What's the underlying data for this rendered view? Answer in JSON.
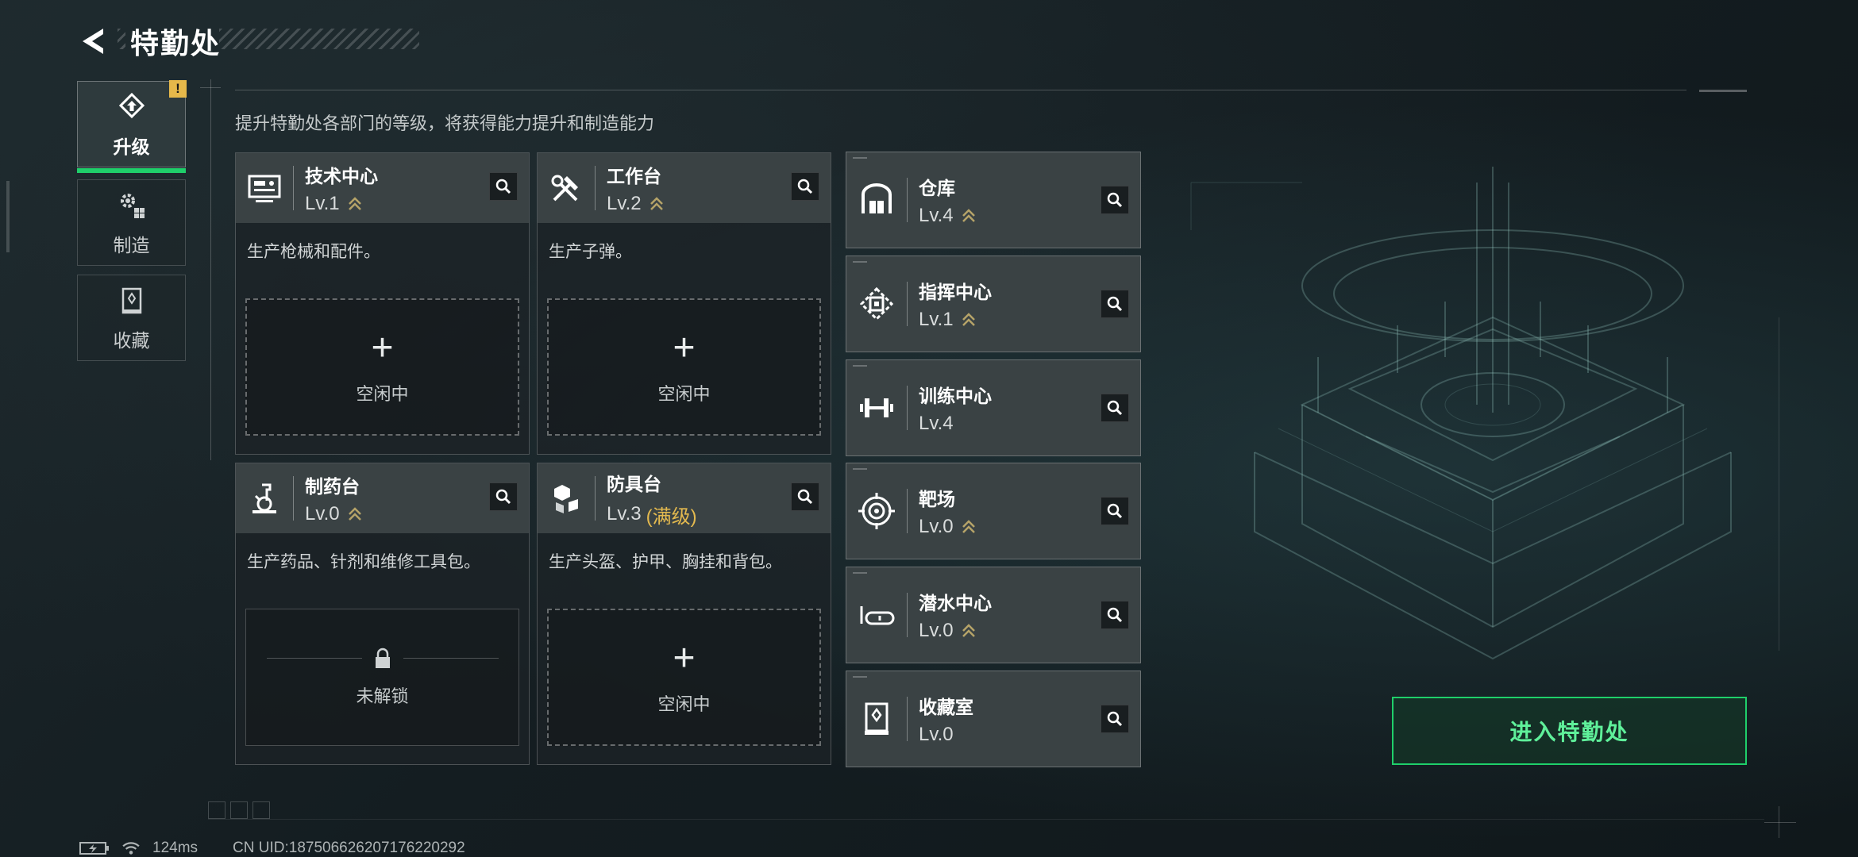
{
  "header": {
    "title": "特勤处"
  },
  "sidebar": {
    "tabs": [
      {
        "label": "升级",
        "icon": "upgrade-icon",
        "active": true,
        "badge": "!"
      },
      {
        "label": "制造",
        "icon": "gears-icon",
        "active": false
      },
      {
        "label": "收藏",
        "icon": "collection-icon",
        "active": false
      }
    ]
  },
  "subtitle": "提升特勤处各部门的等级，将获得能力提升和制造能力",
  "workstations": [
    {
      "name": "技术中心",
      "level": "Lv.1",
      "upgradeable": true,
      "desc": "生产枪械和配件。",
      "slot": "空闲中",
      "icon": "tech-center-icon"
    },
    {
      "name": "工作台",
      "level": "Lv.2",
      "upgradeable": true,
      "desc": "生产子弹。",
      "slot": "空闲中",
      "icon": "workbench-icon"
    },
    {
      "name": "制药台",
      "level": "Lv.0",
      "upgradeable": true,
      "desc": "生产药品、针剂和维修工具包。",
      "slot": "未解锁",
      "icon": "pharmacy-icon"
    },
    {
      "name": "防具台",
      "level": "Lv.3",
      "max_label": "(满级)",
      "upgradeable": false,
      "desc": "生产头盔、护甲、胸挂和背包。",
      "slot": "空闲中",
      "icon": "armor-bench-icon"
    }
  ],
  "facilities": [
    {
      "name": "仓库",
      "level": "Lv.4",
      "upgradeable": true,
      "icon": "warehouse-icon"
    },
    {
      "name": "指挥中心",
      "level": "Lv.1",
      "upgradeable": true,
      "icon": "command-center-icon"
    },
    {
      "name": "训练中心",
      "level": "Lv.4",
      "upgradeable": false,
      "icon": "training-center-icon"
    },
    {
      "name": "靶场",
      "level": "Lv.0",
      "upgradeable": true,
      "icon": "shooting-range-icon"
    },
    {
      "name": "潜水中心",
      "level": "Lv.0",
      "upgradeable": true,
      "icon": "diving-center-icon"
    },
    {
      "name": "收藏室",
      "level": "Lv.0",
      "upgradeable": false,
      "icon": "collection-room-icon"
    }
  ],
  "enter_button": "进入特勤处",
  "status": {
    "ping": "124ms",
    "uid": "CN UID:18750662620717622029​2"
  },
  "colors": {
    "accent": "#1fcf6a",
    "gold": "#e3b94f",
    "card_head": "#3a4244"
  }
}
